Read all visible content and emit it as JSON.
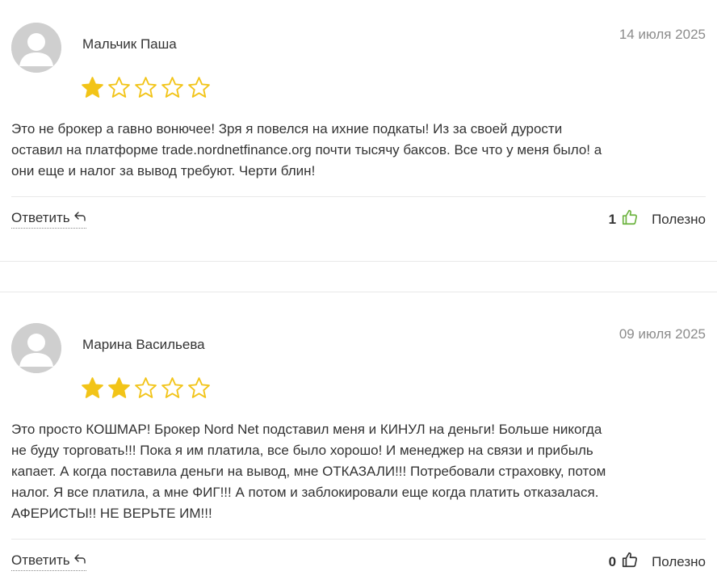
{
  "colors": {
    "star_filled": "#F2C418",
    "star_outline": "#F2C418",
    "thumb_active": "#6CB33F",
    "thumb_default": "#333333",
    "date": "#8C8C8C",
    "text": "#333333"
  },
  "reviews": [
    {
      "author": "Мальчик Паша",
      "date": "14 июля 2025",
      "rating": 1,
      "rating_max": 5,
      "lines": [
        "Это не брокер а гавно вонючее! Зря я повелся на ихние подкаты! Из за своей дурости",
        "оставил на платформе trade.nordnetfinance.org почти тысячу баксов. Все что у меня было! а",
        "они еще и налог за вывод требуют. Черти блин!"
      ],
      "reply_label": "Ответить",
      "reply_icon": "reply-arrow-icon",
      "helpful_count": "1",
      "helpful_icon": "thumbs-up-icon",
      "helpful_label": "Полезно"
    },
    {
      "author": "Марина Васильева",
      "date": "09 июля 2025",
      "rating": 2,
      "rating_max": 5,
      "lines": [
        "Это просто КОШМАР! Брокер Nord Net подставил меня и КИНУЛ на деньги! Больше никогда",
        "не буду торговать!!! Пока я им платила, все было хорошо! И менеджер на связи и прибыль",
        "капает. А когда поставила деньги на вывод, мне ОТКАЗАЛИ!!! Потребовали страховку, потом",
        "налог. Я все платила, а мне ФИГ!!! А потом и заблокировали еще когда платить отказалася.",
        "АФЕРИСТЫ!! НЕ ВЕРЬТЕ ИМ!!!"
      ],
      "reply_label": "Ответить",
      "reply_icon": "reply-arrow-icon",
      "helpful_count": "0",
      "helpful_icon": "thumbs-up-icon",
      "helpful_label": "Полезно"
    }
  ]
}
